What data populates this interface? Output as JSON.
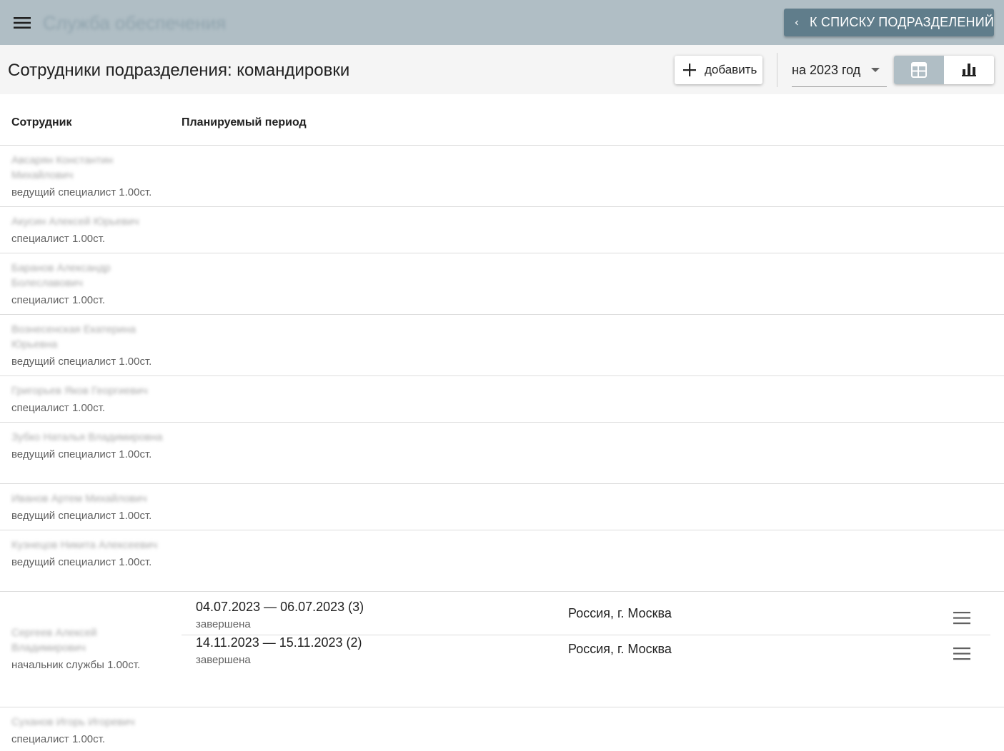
{
  "appbar": {
    "title": "Служба обеспечения",
    "back_label": "К СПИСКУ ПОДРАЗДЕЛЕНИЙ"
  },
  "toolbar": {
    "title": "Сотрудники подразделения: командировки",
    "add_label": "добавить",
    "year_value": "на 2023 год",
    "view_modes": [
      "table-icon",
      "bar-chart-icon"
    ],
    "active_view": "table"
  },
  "table": {
    "headers": {
      "employee": "Сотрудник",
      "period": "Планируемый период"
    },
    "rows": [
      {
        "name": "Авсарян Константин Михайлович",
        "position": "ведущий специалист 1.00ст."
      },
      {
        "name": "Акусин Алексей Юрьевич",
        "position": "специалист 1.00ст."
      },
      {
        "name": "Баранов Александр Болеславович",
        "position": "специалист 1.00ст."
      },
      {
        "name": "Вознесенская Екатерина Юрьевна",
        "position": "ведущий специалист 1.00ст."
      },
      {
        "name": "Григорьев Яков Георгиевич",
        "position": "специалист 1.00ст."
      },
      {
        "name": "Зубко Наталья Владимировна",
        "position": "ведущий специалист 1.00ст."
      },
      {
        "name": "Иванов Артем Михайлович",
        "position": "ведущий специалист 1.00ст."
      },
      {
        "name": "Кузнецов Никита Алексеевич",
        "position": "ведущий специалист 1.00ст."
      },
      {
        "name": "Сергеев Алексей Владимирович",
        "position": "начальник службы 1.00ст.",
        "trips": [
          {
            "period": "04.07.2023 — 06.07.2023 (3)",
            "status": "завершена",
            "place": "Россия, г. Москва"
          },
          {
            "period": "14.11.2023 — 15.11.2023 (2)",
            "status": "завершена",
            "place": "Россия, г. Москва"
          }
        ]
      },
      {
        "name": "Суханов Игорь Игоревич",
        "position": "специалист 1.00ст."
      }
    ]
  },
  "colors": {
    "appbar_bg": "#b0bec5",
    "back_button_bg": "#607d8b",
    "toolbar_bg": "#f5f5f5"
  }
}
